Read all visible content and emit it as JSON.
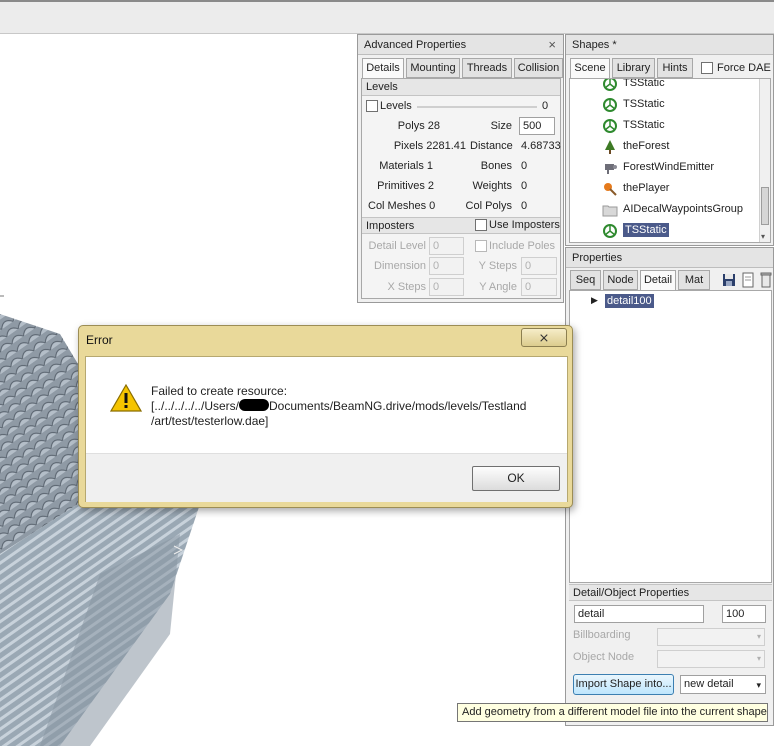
{
  "advanced_properties": {
    "title": "Advanced Properties",
    "close_glyph": "×",
    "tabs": [
      "Details",
      "Mounting",
      "Threads",
      "Collision"
    ],
    "levels_section": "Levels",
    "levels_checkbox_label": "Levels",
    "levels_slider_value": "0",
    "polys_label": "Polys 28",
    "size_label": "Size",
    "size_value": "500",
    "pixels_label": "Pixels 2281.41",
    "distance_label": "Distance",
    "distance_value": "4.68733",
    "materials_label": "Materials 1",
    "bones_label": "Bones",
    "bones_value": "0",
    "primitives_label": "Primitives 2",
    "weights_label": "Weights",
    "weights_value": "0",
    "colmeshes_label": "Col Meshes 0",
    "colpolys_label": "Col Polys",
    "colpolys_value": "0",
    "imposters_section": "Imposters",
    "use_imposters_label": "Use Imposters",
    "detail_level_label": "Detail Level",
    "detail_level_value": "0",
    "include_poles_label": "Include Poles",
    "dimension_label": "Dimension",
    "dimension_value": "0",
    "y_steps_label": "Y Steps",
    "y_steps_value": "0",
    "x_steps_label": "X Steps",
    "x_steps_value": "0",
    "y_angle_label": "Y Angle",
    "y_angle_value": "0"
  },
  "shapes_panel": {
    "title": "Shapes *",
    "tabs": [
      "Scene",
      "Library",
      "Hints"
    ],
    "force_dae_label": "Force DAE",
    "items": [
      {
        "label": "TSStatic",
        "icon": "tsstatic-icon"
      },
      {
        "label": "TSStatic",
        "icon": "tsstatic-icon"
      },
      {
        "label": "TSStatic",
        "icon": "tsstatic-icon"
      },
      {
        "label": "theForest",
        "icon": "tree-icon"
      },
      {
        "label": "ForestWindEmitter",
        "icon": "wind-emitter-icon"
      },
      {
        "label": "thePlayer",
        "icon": "player-icon"
      },
      {
        "label": "AIDecalWaypointsGroup",
        "icon": "folder-icon"
      },
      {
        "label": "TSStatic",
        "icon": "tsstatic-icon"
      }
    ],
    "selected_index": 7
  },
  "properties_panel": {
    "title": "Properties",
    "tabs": [
      "Seq",
      "Node",
      "Detail",
      "Mat"
    ],
    "tree_item": "detail100",
    "detail_object_section": "Detail/Object Properties",
    "detail_name_value": "detail",
    "detail_size_value": "100",
    "billboarding_label": "Billboarding",
    "object_node_label": "Object Node",
    "import_button": "Import Shape into...",
    "new_detail_option": "new detail"
  },
  "error_dialog": {
    "title": "Error",
    "close_glyph": "⨯",
    "message_line1": "Failed to create resource:",
    "message_line2": "[../../../../../Users/",
    "message_line2b": "Documents/BeamNG.drive/mods/levels/Testland",
    "message_line3": "/art/test/testerlow.dae]",
    "ok_button": "OK"
  },
  "tooltip": "Add geometry from a different model file into the current shape",
  "colors": {
    "selection": "#4b5a8a",
    "dialog_frame": "#e9d99a",
    "warning_yellow": "#f5c400"
  }
}
